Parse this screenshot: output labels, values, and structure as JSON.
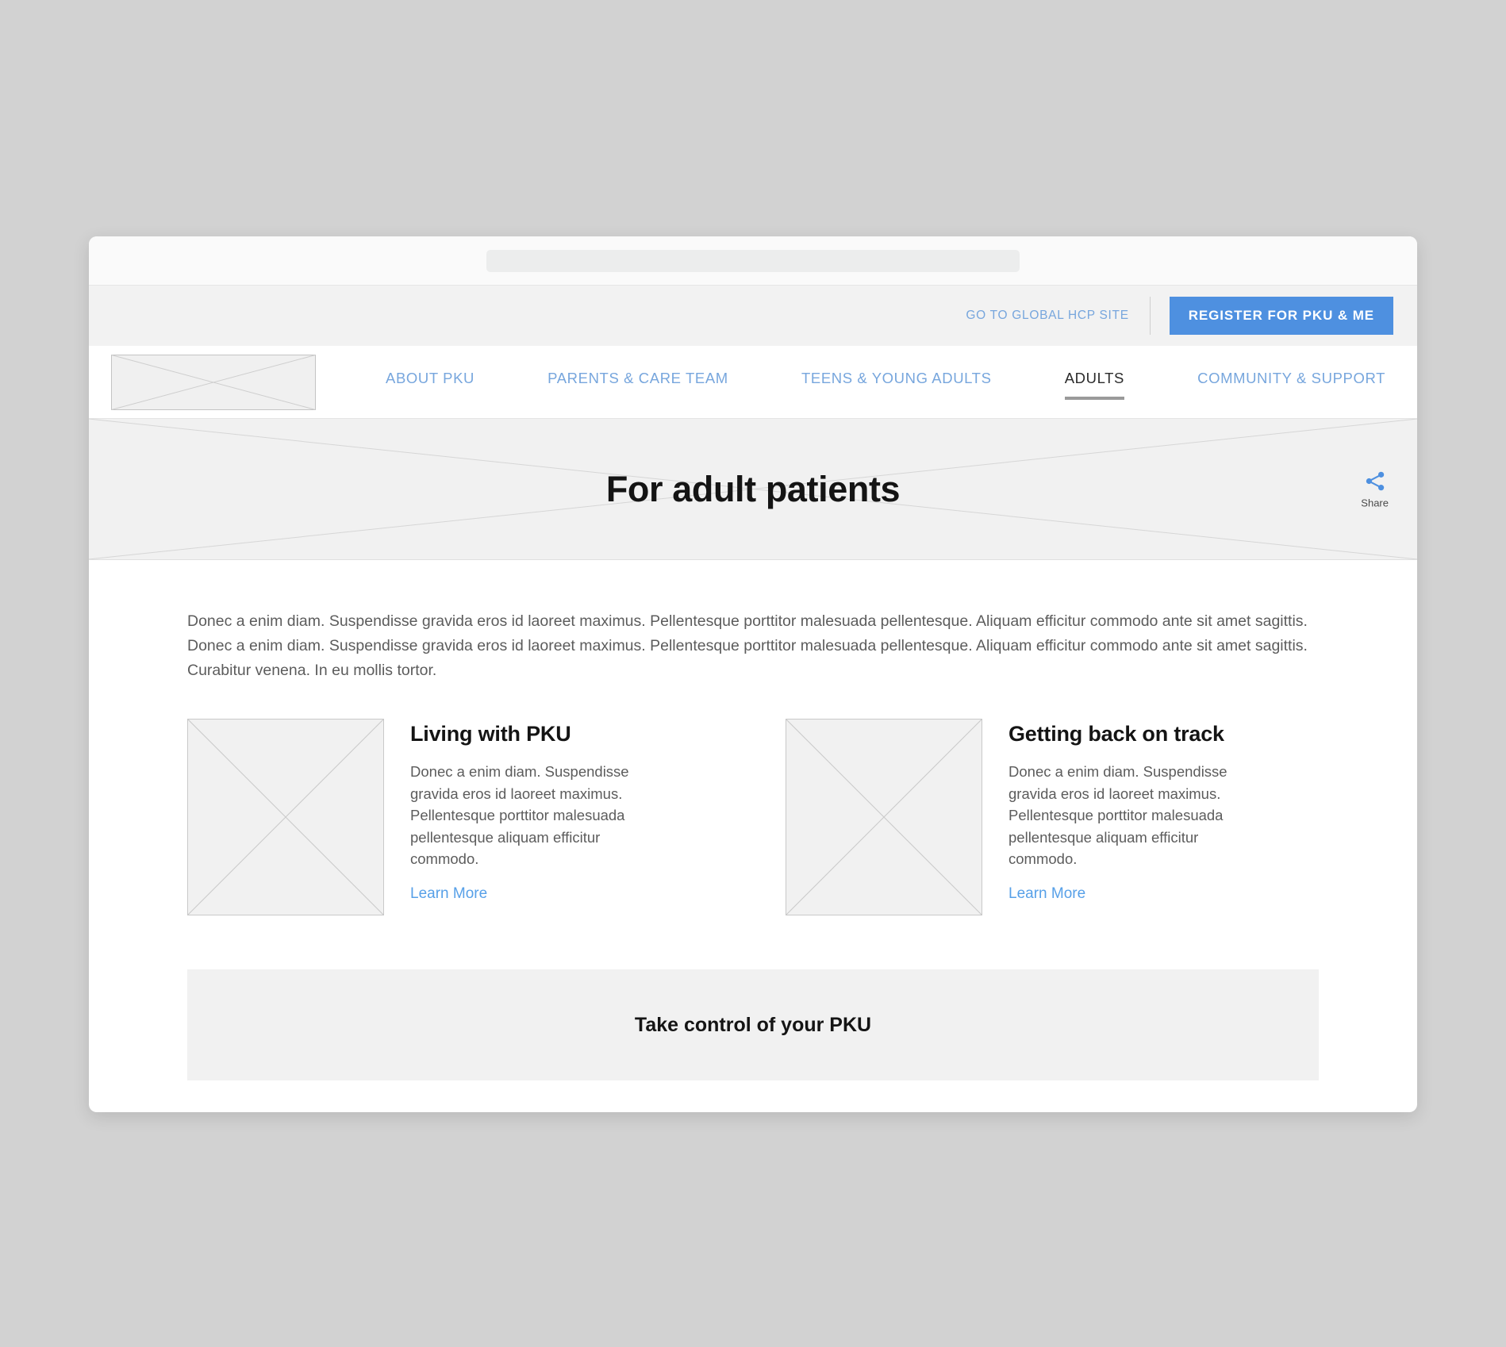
{
  "browser": {
    "address_bar_value": "",
    "address_bar_placeholder": ""
  },
  "utility_bar": {
    "hcp_link": "GO TO GLOBAL HCP SITE",
    "register_button": "REGISTER FOR PKU & ME",
    "register_button_color": "#4e90e0"
  },
  "nav": {
    "logo_alt": "logo-placeholder",
    "items": [
      {
        "label": "ABOUT PKU",
        "active": false
      },
      {
        "label": "PARENTS & CARE TEAM",
        "active": false
      },
      {
        "label": "TEENS & YOUNG ADULTS",
        "active": false
      },
      {
        "label": "ADULTS",
        "active": true
      },
      {
        "label": "COMMUNITY & SUPPORT",
        "active": false
      }
    ],
    "link_color": "#77a6dd",
    "active_color": "#2b2b2b"
  },
  "hero": {
    "title": "For adult patients",
    "share_icon": "share-icon",
    "share_label": "Share",
    "share_icon_color": "#4e90e0"
  },
  "content": {
    "intro": "Donec a enim diam. Suspendisse gravida eros id laoreet maximus. Pellentesque porttitor malesuada pellentesque. Aliquam efficitur commodo ante sit amet sagittis. Donec a enim diam. Suspendisse gravida eros id laoreet maximus. Pellentesque porttitor malesuada pellentesque. Aliquam efficitur commodo ante sit amet sagittis. Curabitur venena. In eu mollis tortor.",
    "cards": [
      {
        "thumb_alt": "image-placeholder",
        "title": "Living with PKU",
        "text": "Donec a enim diam. Suspendisse gravida eros id laoreet maximus. Pellentesque porttitor malesuada pellentesque aliquam efficitur commodo.",
        "link": "Learn More"
      },
      {
        "thumb_alt": "image-placeholder",
        "title": "Getting back on track",
        "text": "Donec a enim diam. Suspendisse gravida eros id laoreet maximus. Pellentesque porttitor malesuada pellentesque aliquam efficitur commodo.",
        "link": "Learn More"
      }
    ],
    "banner_title": "Take control of your PKU"
  }
}
